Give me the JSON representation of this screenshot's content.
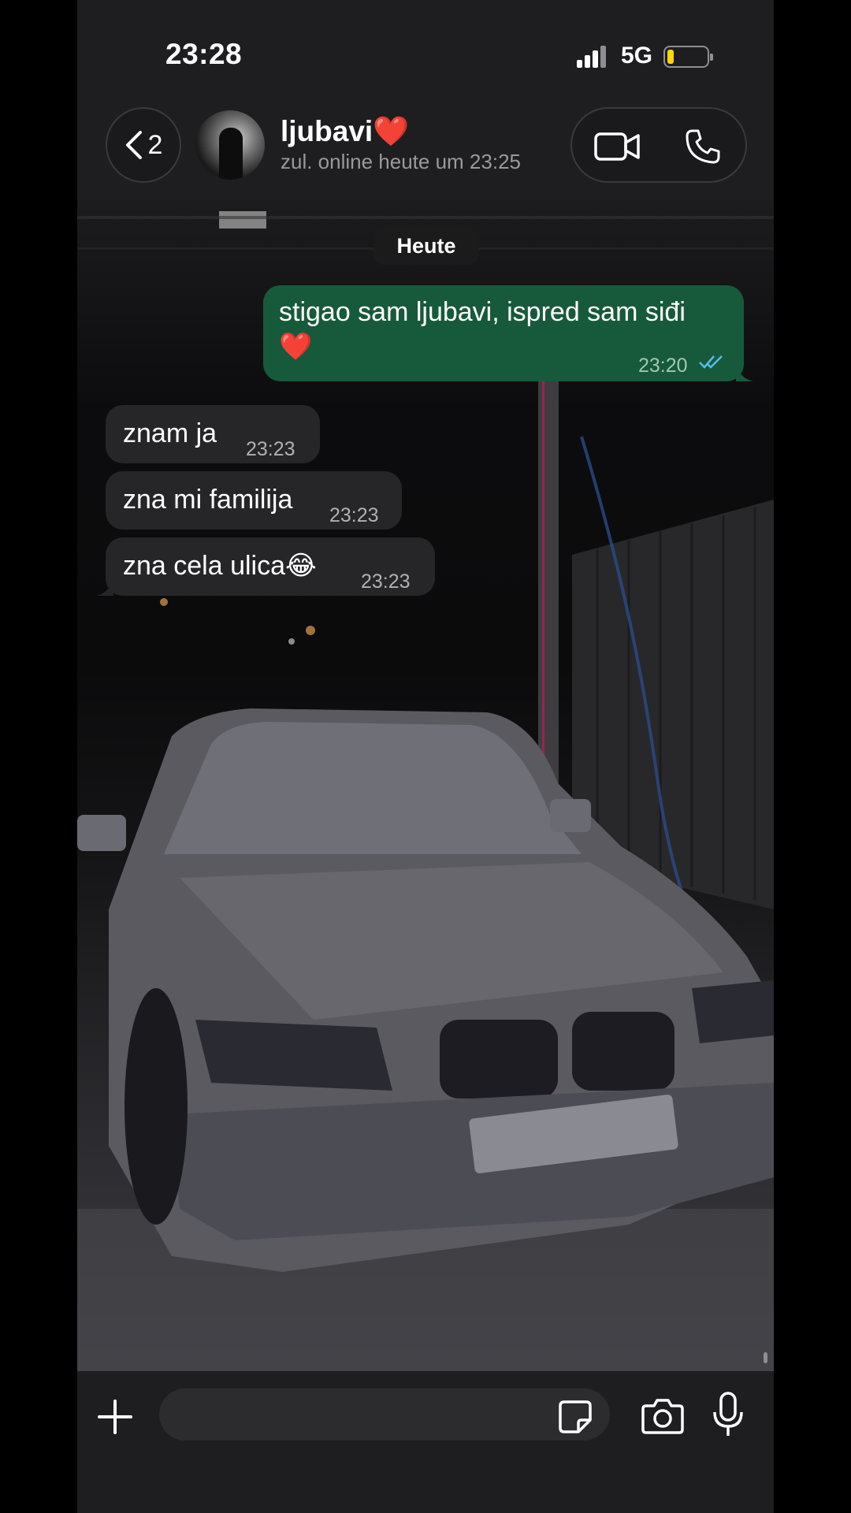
{
  "status_bar": {
    "time": "23:28",
    "network": "5G",
    "battery_level": 0.15
  },
  "header": {
    "back_count": "2",
    "contact_name": "ljubavi❤️",
    "contact_status": "zul. online heute um 23:25",
    "video_call_icon": "video-camera-icon",
    "voice_call_icon": "phone-icon"
  },
  "chat": {
    "date_separator": "Heute",
    "messages": [
      {
        "direction": "outgoing",
        "text_line1": "stigao sam ljubavi, ispred sam siđi",
        "text_line2": "❤️",
        "time": "23:20",
        "status": "read"
      },
      {
        "direction": "incoming",
        "text": "znam ja",
        "time": "23:23"
      },
      {
        "direction": "incoming",
        "text": "zna mi familija",
        "time": "23:23"
      },
      {
        "direction": "incoming",
        "text": "zna cela ulica😂",
        "time": "23:23"
      }
    ]
  },
  "input_bar": {
    "placeholder": "",
    "plus_icon": "plus-icon",
    "sticker_icon": "sticker-icon",
    "camera_icon": "camera-icon",
    "mic_icon": "microphone-icon"
  },
  "colors": {
    "outgoing_bubble": "#175a3b",
    "incoming_bubble": "#262628",
    "read_ticks": "#53bdeb"
  }
}
